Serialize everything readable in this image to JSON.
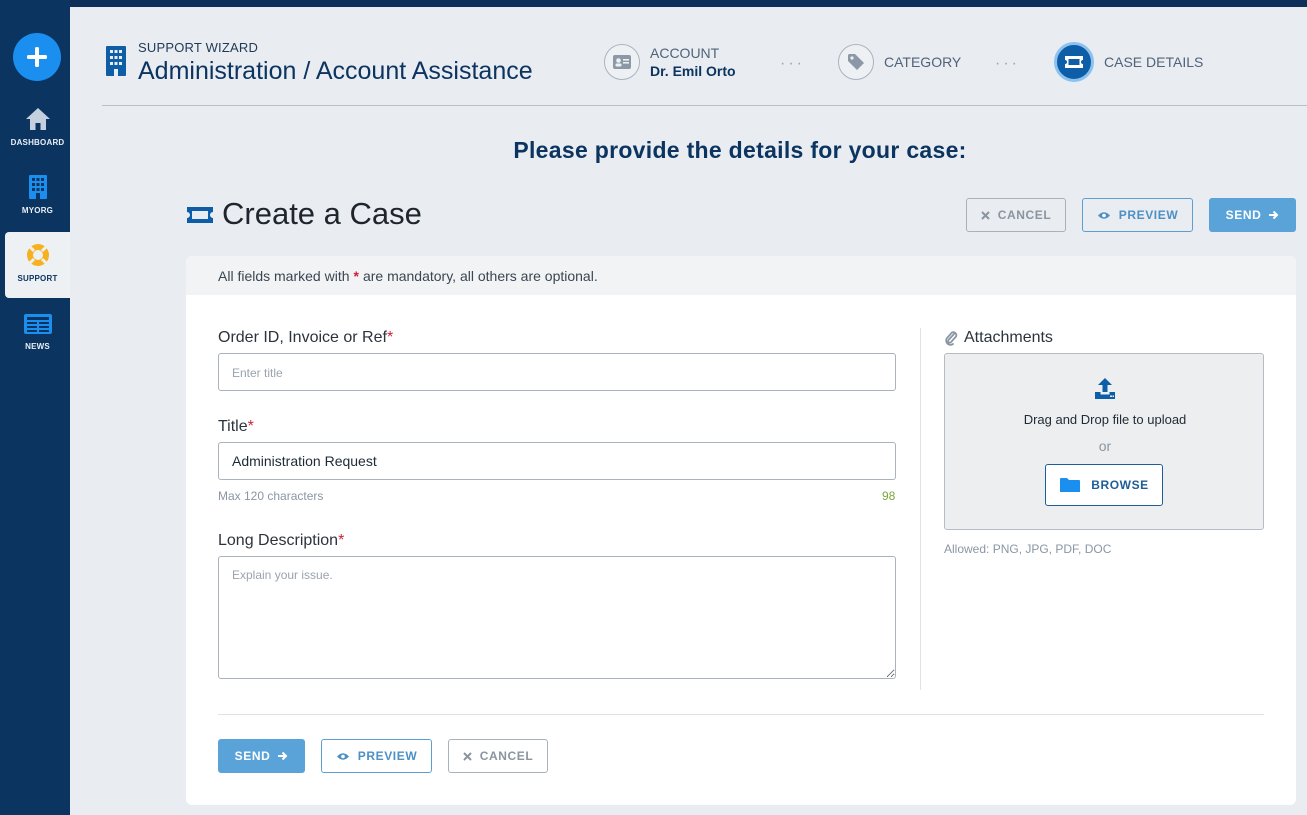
{
  "sidebar": {
    "items": [
      {
        "label": "DASHBOARD",
        "icon": "home-icon"
      },
      {
        "label": "MYORG",
        "icon": "building-icon"
      },
      {
        "label": "SUPPORT",
        "icon": "lifebuoy-icon",
        "active": true
      },
      {
        "label": "NEWS",
        "icon": "newspaper-icon"
      }
    ]
  },
  "header": {
    "wizard_label": "SUPPORT WIZARD",
    "title": "Administration / Account Assistance",
    "steps": [
      {
        "label": "ACCOUNT",
        "sub": "Dr. Emil Orto",
        "icon": "id-card-icon"
      },
      {
        "label": "CATEGORY",
        "icon": "tag-icon"
      },
      {
        "label": "CASE DETAILS",
        "icon": "ticket-icon",
        "active": true
      }
    ],
    "separator": "···"
  },
  "prompt": "Please provide the details for your case:",
  "case": {
    "title": "Create a Case",
    "cancel_label": "CANCEL",
    "preview_label": "PREVIEW",
    "send_label": "SEND"
  },
  "form": {
    "note_before": "All fields marked with",
    "note_star": "*",
    "note_after": "are mandatory, all others are optional.",
    "order": {
      "label": "Order ID, Invoice or Ref",
      "required": "*",
      "placeholder": "Enter title",
      "value": ""
    },
    "title": {
      "label": "Title",
      "required": "*",
      "value": "Administration Request",
      "hint": "Max 120 characters",
      "remaining": "98"
    },
    "description": {
      "label": "Long Description",
      "required": "*",
      "placeholder": "Explain your issue."
    }
  },
  "attachments": {
    "label": "Attachments",
    "drop_text": "Drag and Drop file to upload",
    "or_text": "or",
    "browse_label": "BROWSE",
    "allowed": "Allowed: PNG, JPG, PDF, DOC"
  },
  "colors": {
    "sidebar": "#0c3460",
    "accent": "#1a8ff0",
    "send": "#5aa3d8",
    "required": "#d0203a",
    "support_icon": "#f5b120"
  }
}
